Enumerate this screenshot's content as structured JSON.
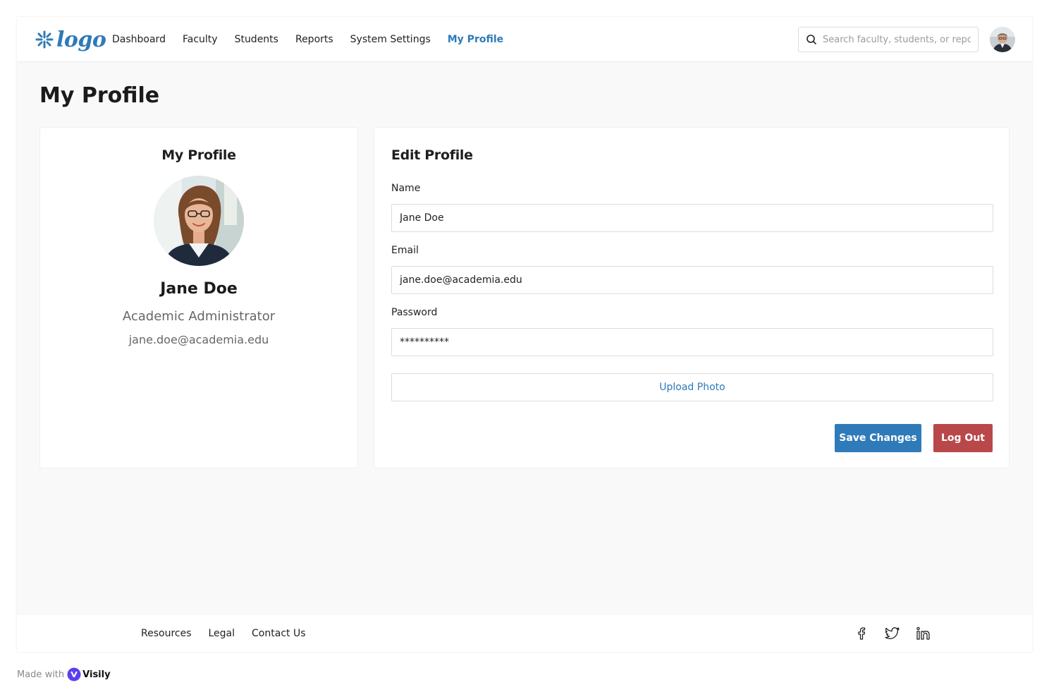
{
  "app": {
    "logo_text": "logo"
  },
  "nav": {
    "items": [
      {
        "label": "Dashboard"
      },
      {
        "label": "Faculty"
      },
      {
        "label": "Students"
      },
      {
        "label": "Reports"
      },
      {
        "label": "System Settings"
      },
      {
        "label": "My Profile",
        "active": true
      }
    ]
  },
  "search": {
    "placeholder": "Search faculty, students, or reports",
    "icon": "search-icon"
  },
  "page": {
    "title": "My Profile"
  },
  "profile_card": {
    "heading": "My Profile",
    "name": "Jane Doe",
    "role": "Academic Administrator",
    "email": "jane.doe@academia.edu"
  },
  "edit_form": {
    "heading": "Edit Profile",
    "name_label": "Name",
    "name_value": "Jane Doe",
    "email_label": "Email",
    "email_value": "jane.doe@academia.edu",
    "password_label": "Password",
    "password_value": "**********",
    "upload_label": "Upload Photo",
    "save_label": "Save Changes",
    "logout_label": "Log Out"
  },
  "footer": {
    "links": [
      {
        "label": "Resources"
      },
      {
        "label": "Legal"
      },
      {
        "label": "Contact Us"
      }
    ],
    "socials": [
      "facebook-icon",
      "twitter-icon",
      "linkedin-icon"
    ]
  },
  "made_with": {
    "prefix": "Made with",
    "brand": "Visily"
  },
  "colors": {
    "accent": "#2f7ab8",
    "danger": "#b9484a",
    "background": "#f9f9f9"
  }
}
